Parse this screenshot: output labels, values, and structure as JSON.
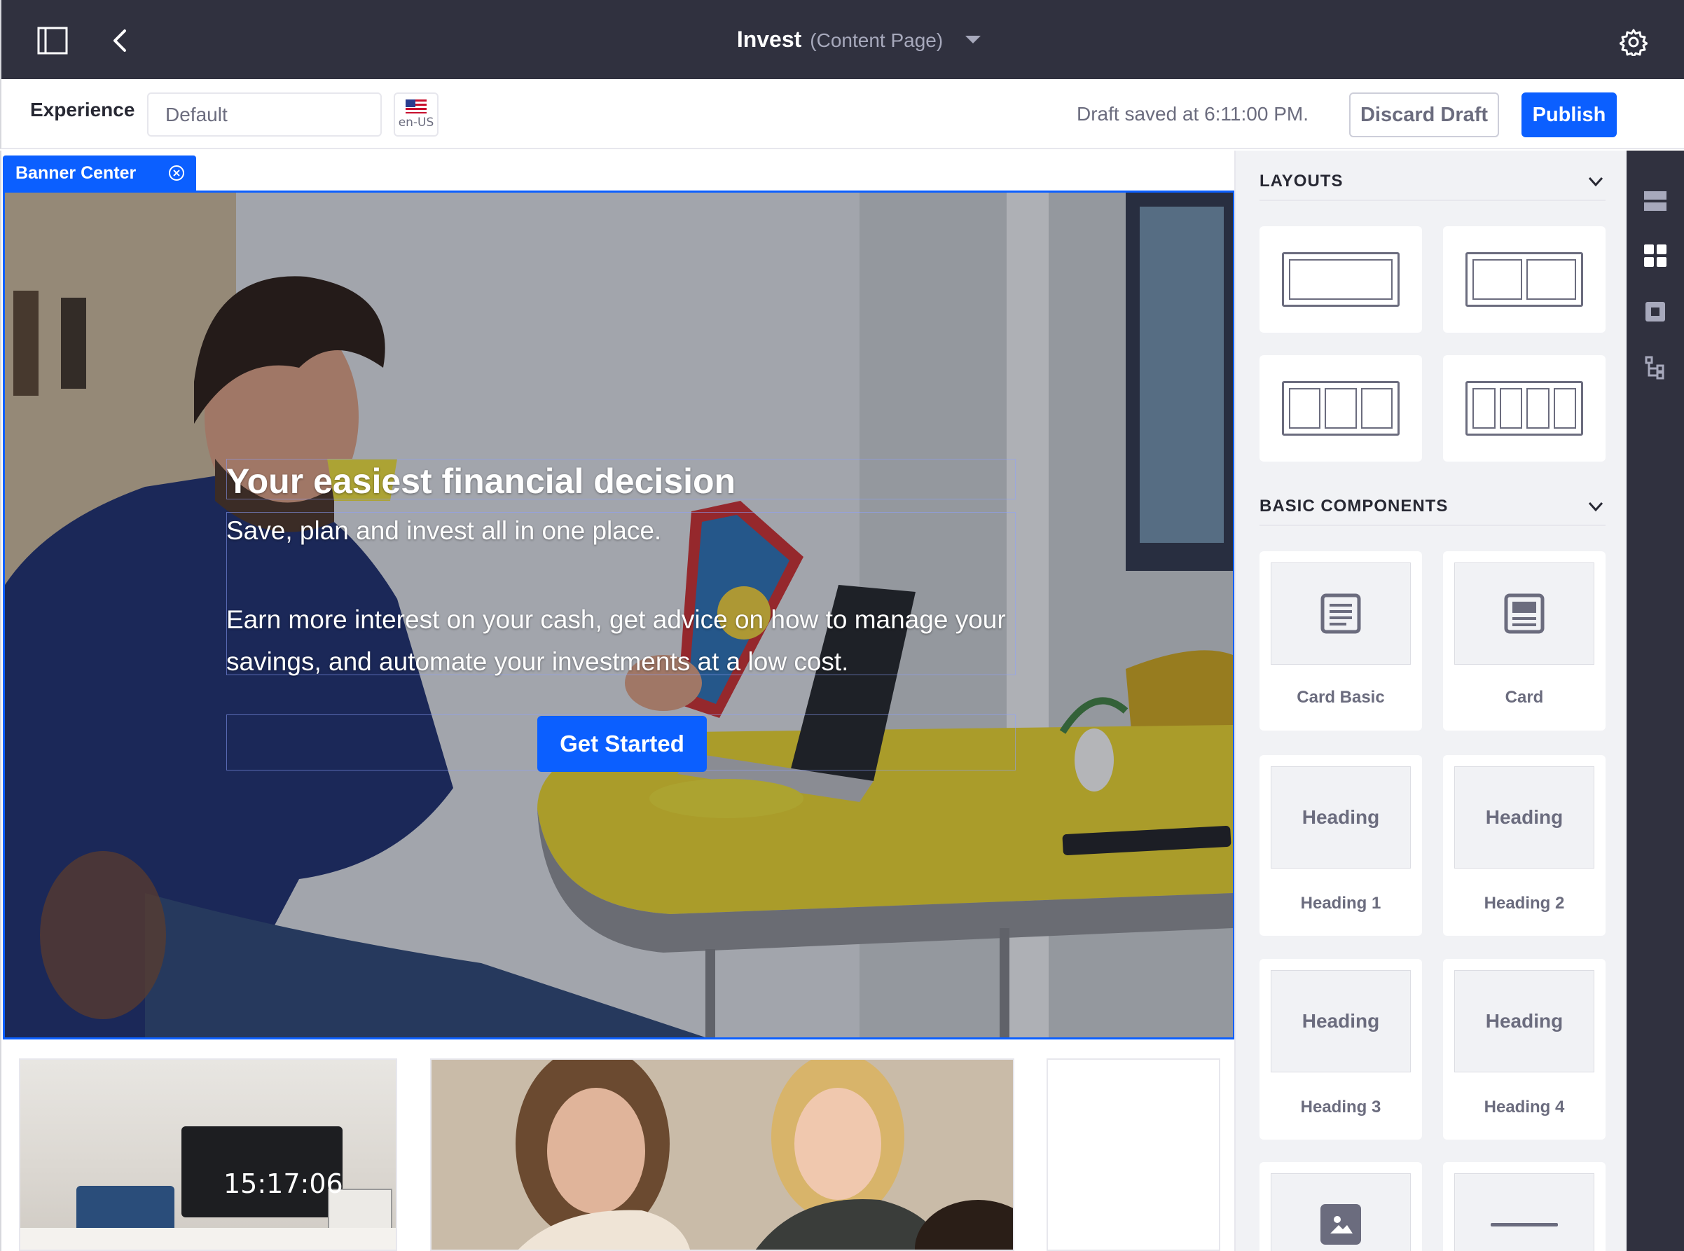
{
  "topbar": {
    "page_title": "Invest",
    "page_type": "(Content Page)",
    "icons": [
      "sidebar-toggle-icon",
      "back-arrow-icon",
      "caret-down-icon",
      "gear-icon"
    ]
  },
  "toolbar": {
    "experience_label": "Experience",
    "experience_value": "Default",
    "locale": "en-US",
    "draft_status": "Draft saved at 6:11:00 PM.",
    "discard_label": "Discard Draft",
    "publish_label": "Publish"
  },
  "canvas": {
    "fragment_tag": "Banner Center",
    "hero": {
      "heading": "Your easiest financial decision",
      "subheading": "Save, plan and invest all in one place.",
      "body": "Earn more interest on your cash, get advice on how to manage your savings, and automate your investments at a low cost.",
      "cta": "Get Started"
    },
    "clock_display": "15:17:06"
  },
  "panel": {
    "layouts_title": "LAYOUTS",
    "layouts": [
      {
        "name": "1 column",
        "columns": 1
      },
      {
        "name": "2 columns",
        "columns": 2
      },
      {
        "name": "3 columns",
        "columns": 3
      },
      {
        "name": "4 columns",
        "columns": 4
      }
    ],
    "basic_components_title": "BASIC COMPONENTS",
    "components": [
      {
        "label": "Card Basic",
        "preview": "",
        "icon": "card-basic-icon"
      },
      {
        "label": "Card",
        "preview": "",
        "icon": "card-icon"
      },
      {
        "label": "Heading 1",
        "preview": "Heading",
        "icon": ""
      },
      {
        "label": "Heading 2",
        "preview": "Heading",
        "icon": ""
      },
      {
        "label": "Heading 3",
        "preview": "Heading",
        "icon": ""
      },
      {
        "label": "Heading 4",
        "preview": "Heading",
        "icon": ""
      },
      {
        "label": "",
        "preview": "",
        "icon": "image-icon"
      },
      {
        "label": "",
        "preview": "",
        "icon": "separator-icon"
      }
    ]
  },
  "rail": {
    "icons": [
      "page-structure-icon",
      "fragments-grid-icon",
      "widgets-icon",
      "tree-icon"
    ]
  },
  "colors": {
    "topbar_bg": "#30313f",
    "primary": "#0b5fff",
    "panel_bg": "#f1f2f5",
    "muted_text": "#6b6c7e"
  }
}
